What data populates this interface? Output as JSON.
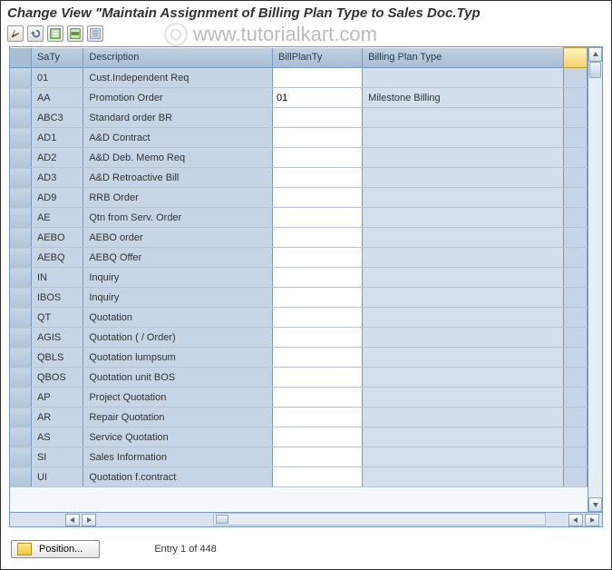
{
  "title": "Change View \"Maintain Assignment of Billing Plan Type to Sales Doc.Typ",
  "watermark": "www.tutorialkart.com",
  "columns": {
    "saty": "SaTy",
    "desc": "Description",
    "billplanty": "BillPlanTy",
    "billplantype": "Billing Plan Type"
  },
  "rows": [
    {
      "saty": "01",
      "desc": "Cust.Independent Req",
      "billplanty": "",
      "billplantype": ""
    },
    {
      "saty": "AA",
      "desc": "Promotion Order",
      "billplanty": "01",
      "billplantype": "Milestone Billing"
    },
    {
      "saty": "ABC3",
      "desc": "Standard order BR",
      "billplanty": "",
      "billplantype": ""
    },
    {
      "saty": "AD1",
      "desc": "A&D Contract",
      "billplanty": "",
      "billplantype": ""
    },
    {
      "saty": "AD2",
      "desc": "A&D Deb. Memo Req",
      "billplanty": "",
      "billplantype": ""
    },
    {
      "saty": "AD3",
      "desc": "A&D Retroactive Bill",
      "billplanty": "",
      "billplantype": ""
    },
    {
      "saty": "AD9",
      "desc": "RRB Order",
      "billplanty": "",
      "billplantype": ""
    },
    {
      "saty": "AE",
      "desc": "Qtn from Serv. Order",
      "billplanty": "",
      "billplantype": ""
    },
    {
      "saty": "AEBO",
      "desc": "AEBO order",
      "billplanty": "",
      "billplantype": ""
    },
    {
      "saty": "AEBQ",
      "desc": "AEBQ Offer",
      "billplanty": "",
      "billplantype": ""
    },
    {
      "saty": "IN",
      "desc": "Inquiry",
      "billplanty": "",
      "billplantype": ""
    },
    {
      "saty": "IBOS",
      "desc": "Inquiry",
      "billplanty": "",
      "billplantype": ""
    },
    {
      "saty": "QT",
      "desc": "Quotation",
      "billplanty": "",
      "billplantype": ""
    },
    {
      "saty": "AGIS",
      "desc": "Quotation ( / Order)",
      "billplanty": "",
      "billplantype": ""
    },
    {
      "saty": "QBLS",
      "desc": "Quotation lumpsum",
      "billplanty": "",
      "billplantype": ""
    },
    {
      "saty": "QBOS",
      "desc": "Quotation unit BOS",
      "billplanty": "",
      "billplantype": ""
    },
    {
      "saty": "AP",
      "desc": "Project Quotation",
      "billplanty": "",
      "billplantype": ""
    },
    {
      "saty": "AR",
      "desc": "Repair Quotation",
      "billplanty": "",
      "billplantype": ""
    },
    {
      "saty": "AS",
      "desc": "Service Quotation",
      "billplanty": "",
      "billplantype": ""
    },
    {
      "saty": "SI",
      "desc": "Sales Information",
      "billplanty": "",
      "billplantype": ""
    },
    {
      "saty": "UI",
      "desc": "Quotation f.contract",
      "billplanty": "",
      "billplantype": ""
    }
  ],
  "position_button": "Position...",
  "entry_status": "Entry 1 of 448"
}
